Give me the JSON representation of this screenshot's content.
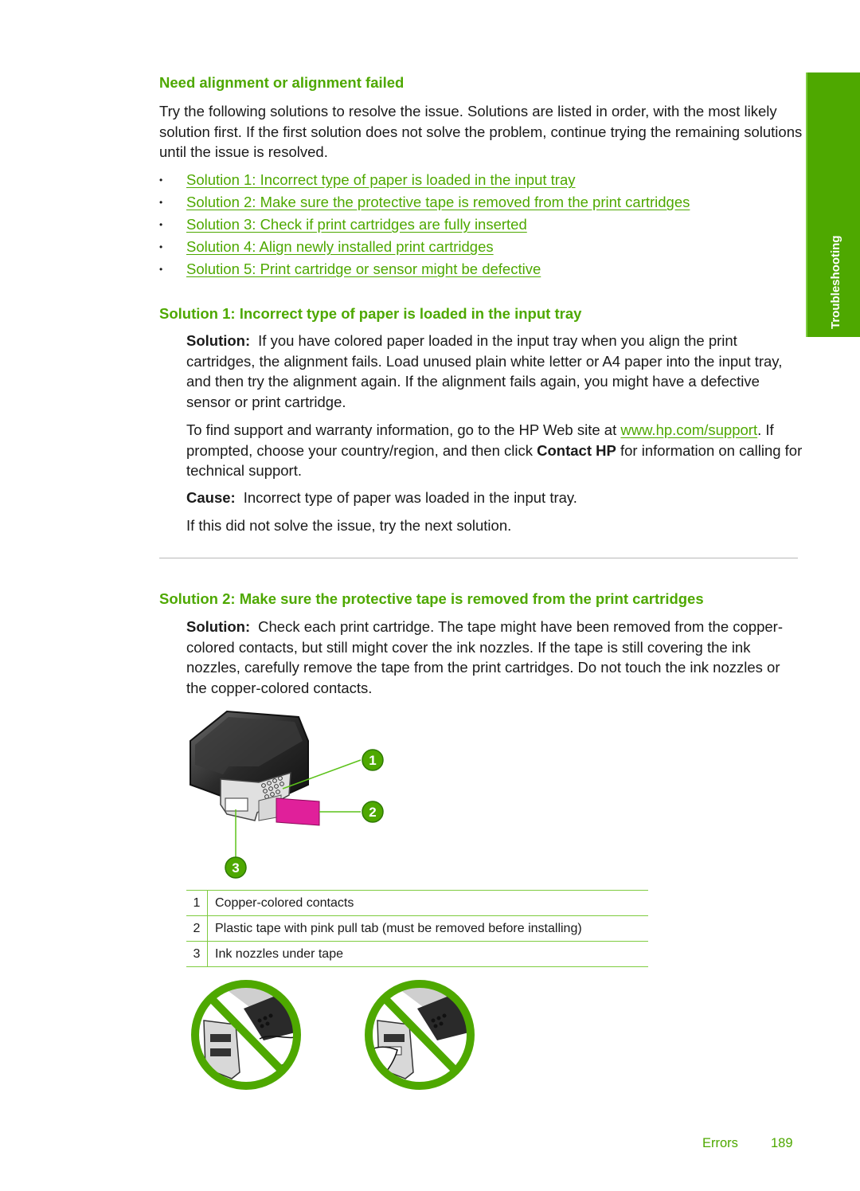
{
  "side_tab": {
    "label": "Troubleshooting",
    "color": "#4ea800"
  },
  "section": {
    "title": "Need alignment or alignment failed",
    "intro": "Try the following solutions to resolve the issue. Solutions are listed in order, with the most likely solution first. If the first solution does not solve the problem, continue trying the remaining solutions until the issue is resolved.",
    "links": [
      {
        "label": "Solution 1: Incorrect type of paper is loaded in the input tray"
      },
      {
        "label": "Solution 2: Make sure the protective tape is removed from the print cartridges"
      },
      {
        "label": "Solution 3: Check if print cartridges are fully inserted"
      },
      {
        "label": "Solution 4: Align newly installed print cartridges"
      },
      {
        "label": "Solution 5: Print cartridge or sensor might be defective"
      }
    ]
  },
  "solution1": {
    "heading": "Solution 1: Incorrect type of paper is loaded in the input tray",
    "solution_label": "Solution:",
    "solution_text": "If you have colored paper loaded in the input tray when you align the print cartridges, the alignment fails. Load unused plain white letter or A4 paper into the input tray, and then try the alignment again. If the alignment fails again, you might have a defective sensor or print cartridge.",
    "support_pre": "To find support and warranty information, go to the HP Web site at ",
    "support_link": "www.hp.com/support",
    "support_mid": ". If prompted, choose your country/region, and then click ",
    "support_bold": "Contact HP",
    "support_post": " for information on calling for technical support.",
    "cause_label": "Cause:",
    "cause_text": "Incorrect type of paper was loaded in the input tray.",
    "next": "If this did not solve the issue, try the next solution."
  },
  "solution2": {
    "heading": "Solution 2: Make sure the protective tape is removed from the print cartridges",
    "solution_label": "Solution:",
    "solution_text": "Check each print cartridge. The tape might have been removed from the copper-colored contacts, but still might cover the ink nozzles. If the tape is still covering the ink nozzles, carefully remove the tape from the print cartridges. Do not touch the ink nozzles or the copper-colored contacts.",
    "callouts": [
      "1",
      "2",
      "3"
    ],
    "legend": [
      {
        "num": "1",
        "desc": "Copper-colored contacts"
      },
      {
        "num": "2",
        "desc": "Plastic tape with pink pull tab (must be removed before installing)"
      },
      {
        "num": "3",
        "desc": "Ink nozzles under tape"
      }
    ]
  },
  "footer": {
    "section": "Errors",
    "page": "189"
  }
}
